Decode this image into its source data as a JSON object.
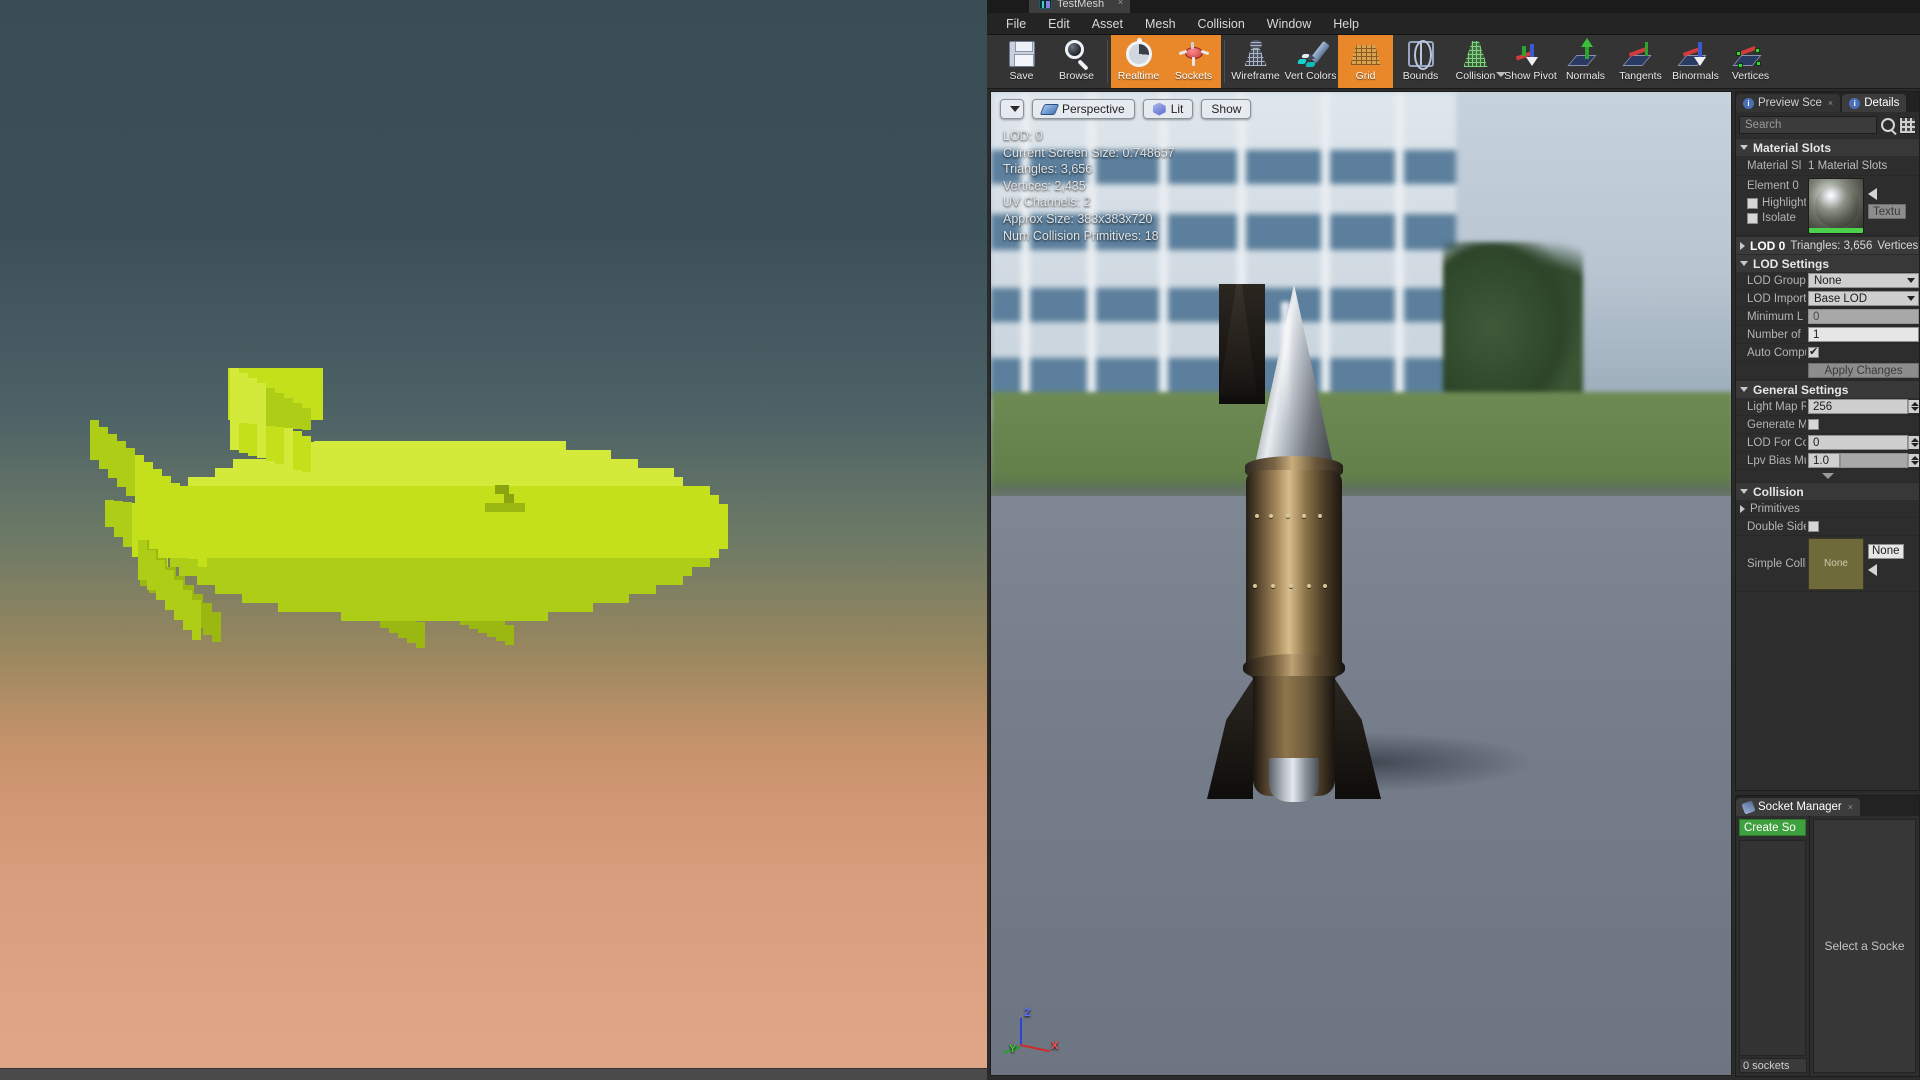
{
  "window": {
    "asset_tab_title": "TestMesh",
    "tab_close": "×"
  },
  "menubar": {
    "items": [
      {
        "label": "File"
      },
      {
        "label": "Edit"
      },
      {
        "label": "Asset"
      },
      {
        "label": "Mesh"
      },
      {
        "label": "Collision"
      },
      {
        "label": "Window"
      },
      {
        "label": "Help"
      }
    ]
  },
  "toolbar": {
    "buttons": [
      {
        "label": "Save",
        "icon": "floppy-disk-icon",
        "active": false
      },
      {
        "label": "Browse",
        "icon": "magnifier-icon",
        "active": false
      },
      {
        "label": "Realtime",
        "icon": "stopwatch-icon",
        "active": true
      },
      {
        "label": "Sockets",
        "icon": "socket-icon",
        "active": true
      },
      {
        "label": "Wireframe",
        "icon": "wireframe-icon",
        "active": false
      },
      {
        "label": "Vert Colors",
        "icon": "vertex-colors-icon",
        "active": false
      },
      {
        "label": "Grid",
        "icon": "grid-icon",
        "active": true
      },
      {
        "label": "Bounds",
        "icon": "bounds-icon",
        "active": false
      },
      {
        "label": "Collision",
        "icon": "collision-icon",
        "active": false,
        "has_dropdown": true
      },
      {
        "label": "Show Pivot",
        "icon": "pivot-icon",
        "active": false
      },
      {
        "label": "Normals",
        "icon": "normals-icon",
        "active": false
      },
      {
        "label": "Tangents",
        "icon": "tangents-icon",
        "active": false
      },
      {
        "label": "Binormals",
        "icon": "binormals-icon",
        "active": false
      },
      {
        "label": "Vertices",
        "icon": "vertices-icon",
        "active": false
      }
    ]
  },
  "viewport": {
    "toolbar": {
      "view_menu_caret": "",
      "perspective_label": "Perspective",
      "lit_label": "Lit",
      "show_label": "Show"
    },
    "stats": [
      "LOD: 0",
      "Current Screen Size: 0.748657",
      "Triangles: 3,656",
      "Vertices: 2,435",
      "UV Channels: 2",
      "Approx Size: 383x383x720",
      "Num Collision Primitives: 18"
    ],
    "axis": {
      "x": "X",
      "y": "Y",
      "z": "Z"
    }
  },
  "details": {
    "tabs": [
      {
        "label": "Preview Sce",
        "active": false,
        "close": "×"
      },
      {
        "label": "Details",
        "active": true,
        "close": ""
      }
    ],
    "search_placeholder": "Search",
    "sections": {
      "material_slots": {
        "title": "Material Slots",
        "row_label": "Material Sl",
        "row_value": "1 Material Slots",
        "element_label": "Element 0",
        "highlight_label": "Highlight",
        "isolate_label": "Isolate",
        "texture_button": "Textu"
      },
      "lod0_bar": {
        "name": "LOD 0",
        "triangles": "Triangles: 3,656",
        "vertices": "Vertices:"
      },
      "lod_settings": {
        "title": "LOD Settings",
        "rows": [
          {
            "label": "LOD Group",
            "value": "None",
            "type": "combo"
          },
          {
            "label": "LOD Import",
            "value": "Base LOD",
            "type": "combo"
          },
          {
            "label": "Minimum L",
            "value": "0",
            "type": "disabled"
          },
          {
            "label": "Number of",
            "value": "1",
            "type": "text"
          },
          {
            "label": "Auto Compu",
            "value": "",
            "type": "checkbox",
            "checked": true
          }
        ],
        "apply_button": "Apply Changes"
      },
      "general_settings": {
        "title": "General Settings",
        "rows": [
          {
            "label": "Light Map R",
            "value": "256",
            "type": "spinner"
          },
          {
            "label": "Generate M",
            "value": "",
            "type": "checkbox",
            "checked": false
          },
          {
            "label": "LOD For Col",
            "value": "0",
            "type": "spinner"
          },
          {
            "label": "Lpv Bias Mu",
            "value": "1.0",
            "type": "spinner-split"
          }
        ]
      },
      "collision": {
        "title": "Collision",
        "primitives_label": "Primitives",
        "double_sided_label": "Double Side",
        "double_sided_checked": false,
        "simple_collision_label": "Simple Colli",
        "thumb_label": "None",
        "asset_name": "None"
      }
    }
  },
  "socket_manager": {
    "tab_label": "Socket Manager",
    "tab_close": "×",
    "create_button": "Create So",
    "count_label": "0 sockets",
    "empty_message": "Select a Socke"
  },
  "colors": {
    "accent_orange": "#e8882a",
    "create_green": "#3fa03f",
    "panel_bg": "#2d2d2d",
    "toolbar_bg": "#343434"
  }
}
